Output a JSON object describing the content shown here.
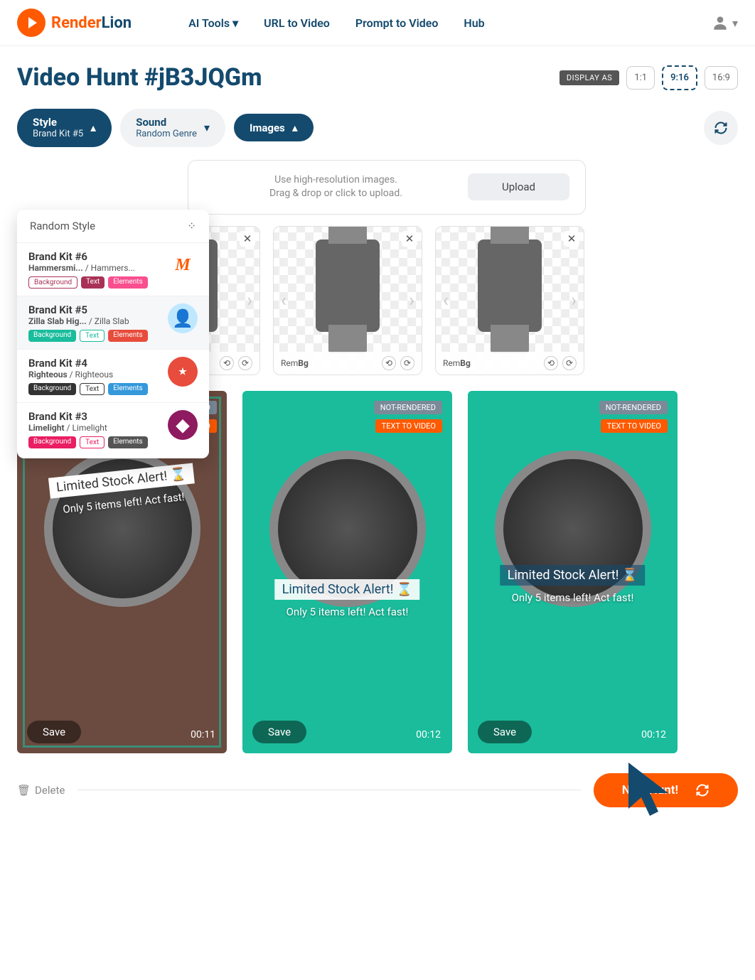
{
  "header": {
    "logo_render": "Render",
    "logo_lion": "Lion",
    "nav": {
      "ai_tools": "AI Tools",
      "url_to_video": "URL to Video",
      "prompt_to_video": "Prompt to Video",
      "hub": "Hub"
    }
  },
  "page": {
    "title": "Video Hunt #jB3JQGm",
    "display_as_label": "DISPLAY AS",
    "ratios": {
      "r11": "1:1",
      "r916": "9:16",
      "r169": "16:9"
    }
  },
  "controls": {
    "style_label": "Style",
    "style_value": "Brand Kit #5",
    "sound_label": "Sound",
    "sound_value": "Random Genre",
    "images_label": "Images"
  },
  "dropdown": {
    "header": "Random Style",
    "items": [
      {
        "title": "Brand Kit #6",
        "font1": "Hammersmi...",
        "font2": "Hammers...",
        "bg": "Background",
        "txt": "Text",
        "el": "Elements",
        "glyph": "M",
        "glyph_color": "#ff5a00"
      },
      {
        "title": "Brand Kit #5",
        "font1": "Zilla Slab Hig...",
        "font2": "Zilla Slab",
        "bg": "Background",
        "txt": "Text",
        "el": "Elements",
        "glyph": "👤",
        "glyph_color": "#1abc9c"
      },
      {
        "title": "Brand Kit #4",
        "font1": "Righteous",
        "font2": "Righteous",
        "bg": "Background",
        "txt": "Text",
        "el": "Elements",
        "glyph": "★",
        "glyph_color": "#e74c3c"
      },
      {
        "title": "Brand Kit #3",
        "font1": "Limelight",
        "font2": "Limelight",
        "bg": "Background",
        "txt": "Text",
        "el": "Elements",
        "glyph": "◆",
        "glyph_color": "#8e1a5f"
      }
    ]
  },
  "upload": {
    "line1": "Use high-resolution images.",
    "line2": "Drag & drop or click to upload.",
    "button": "Upload"
  },
  "thumbs": {
    "rembg_prefix": "Rem",
    "rembg_bold": "Bg"
  },
  "results": {
    "badge_nr": "NOT-RENDERED",
    "badge_ttv": "TEXT TO VIDEO",
    "overlay_title": "Limited Stock Alert! ⌛",
    "overlay_sub": "Only 5 items left! Act fast!",
    "save": "Save",
    "durations": [
      "00:11",
      "00:12",
      "00:12"
    ]
  },
  "footer": {
    "delete": "Delete",
    "new_hunt": "New Hunt!"
  }
}
